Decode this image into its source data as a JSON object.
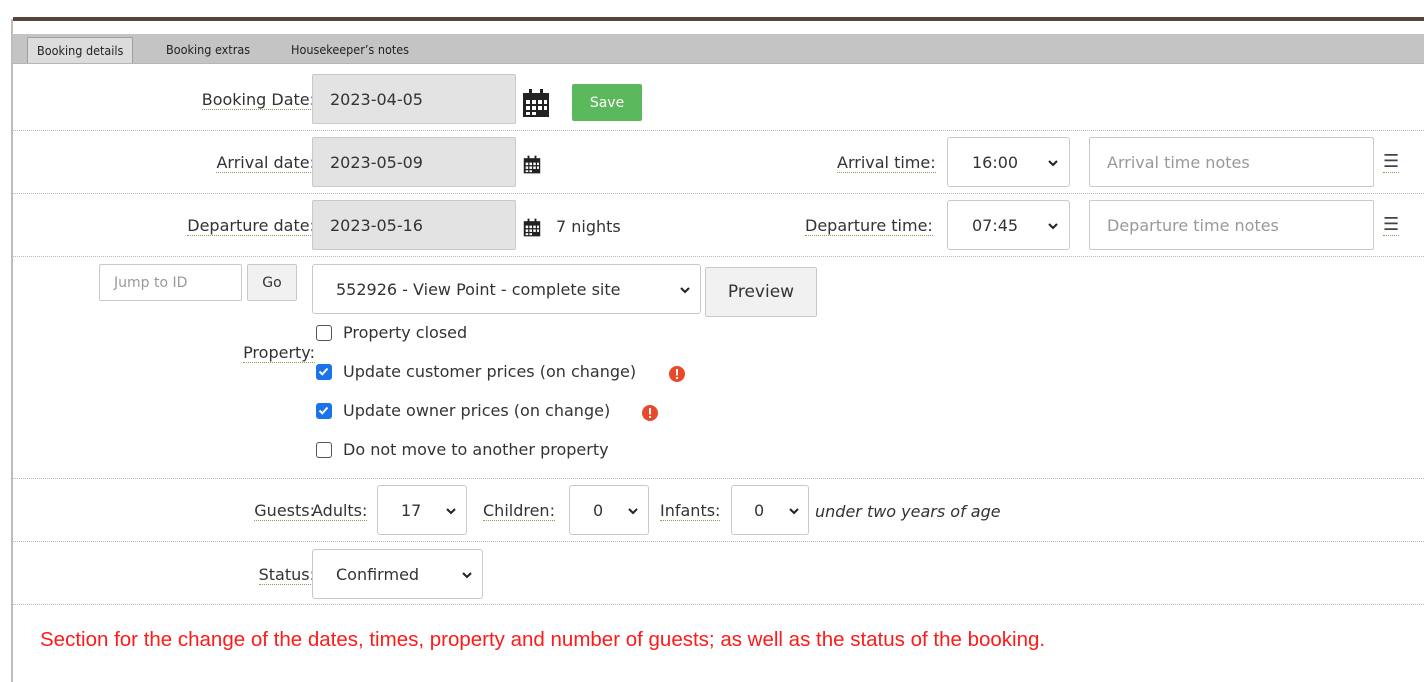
{
  "tabs": [
    {
      "label": "Booking details",
      "active": true
    },
    {
      "label": "Booking extras",
      "active": false
    },
    {
      "label": "Housekeeper’s notes",
      "active": false
    }
  ],
  "booking_date": {
    "label": "Booking Date:",
    "value": "2023-04-05",
    "save_label": "Save"
  },
  "arrival": {
    "label": "Arrival date:",
    "value": "2023-05-09",
    "time_label": "Arrival time:",
    "time_value": "16:00",
    "notes_placeholder": "Arrival time notes"
  },
  "departure": {
    "label": "Departure date:",
    "value": "2023-05-16",
    "nights": "7 nights",
    "time_label": "Departure time:",
    "time_value": "07:45",
    "notes_placeholder": "Departure time notes"
  },
  "property": {
    "jump_placeholder": "Jump to ID",
    "go_label": "Go",
    "label": "Property:",
    "selected": "552926 - View Point - complete site",
    "preview_label": "Preview",
    "checkboxes": [
      {
        "label": "Property closed",
        "checked": false,
        "warning": false
      },
      {
        "label": "Update customer prices (on change)",
        "checked": true,
        "warning": true
      },
      {
        "label": "Update owner prices (on change)",
        "checked": true,
        "warning": true
      },
      {
        "label": "Do not move to another property",
        "checked": false,
        "warning": false
      }
    ]
  },
  "guests": {
    "label": "Guests:",
    "adults_label": "Adults:",
    "adults_value": "17",
    "children_label": "Children:",
    "children_value": "0",
    "infants_label": "Infants:",
    "infants_value": "0",
    "infants_note": "under two years of age"
  },
  "status": {
    "label": "Status:",
    "value": "Confirmed"
  },
  "caption": "Section for the change of the dates, times, property and number of guests; as well as the status of the booking.",
  "colors": {
    "accent_green": "#5cb85c",
    "checkbox_blue": "#1a73e8",
    "warning_red": "#e8492b",
    "caption_red": "#ff1a1a"
  }
}
